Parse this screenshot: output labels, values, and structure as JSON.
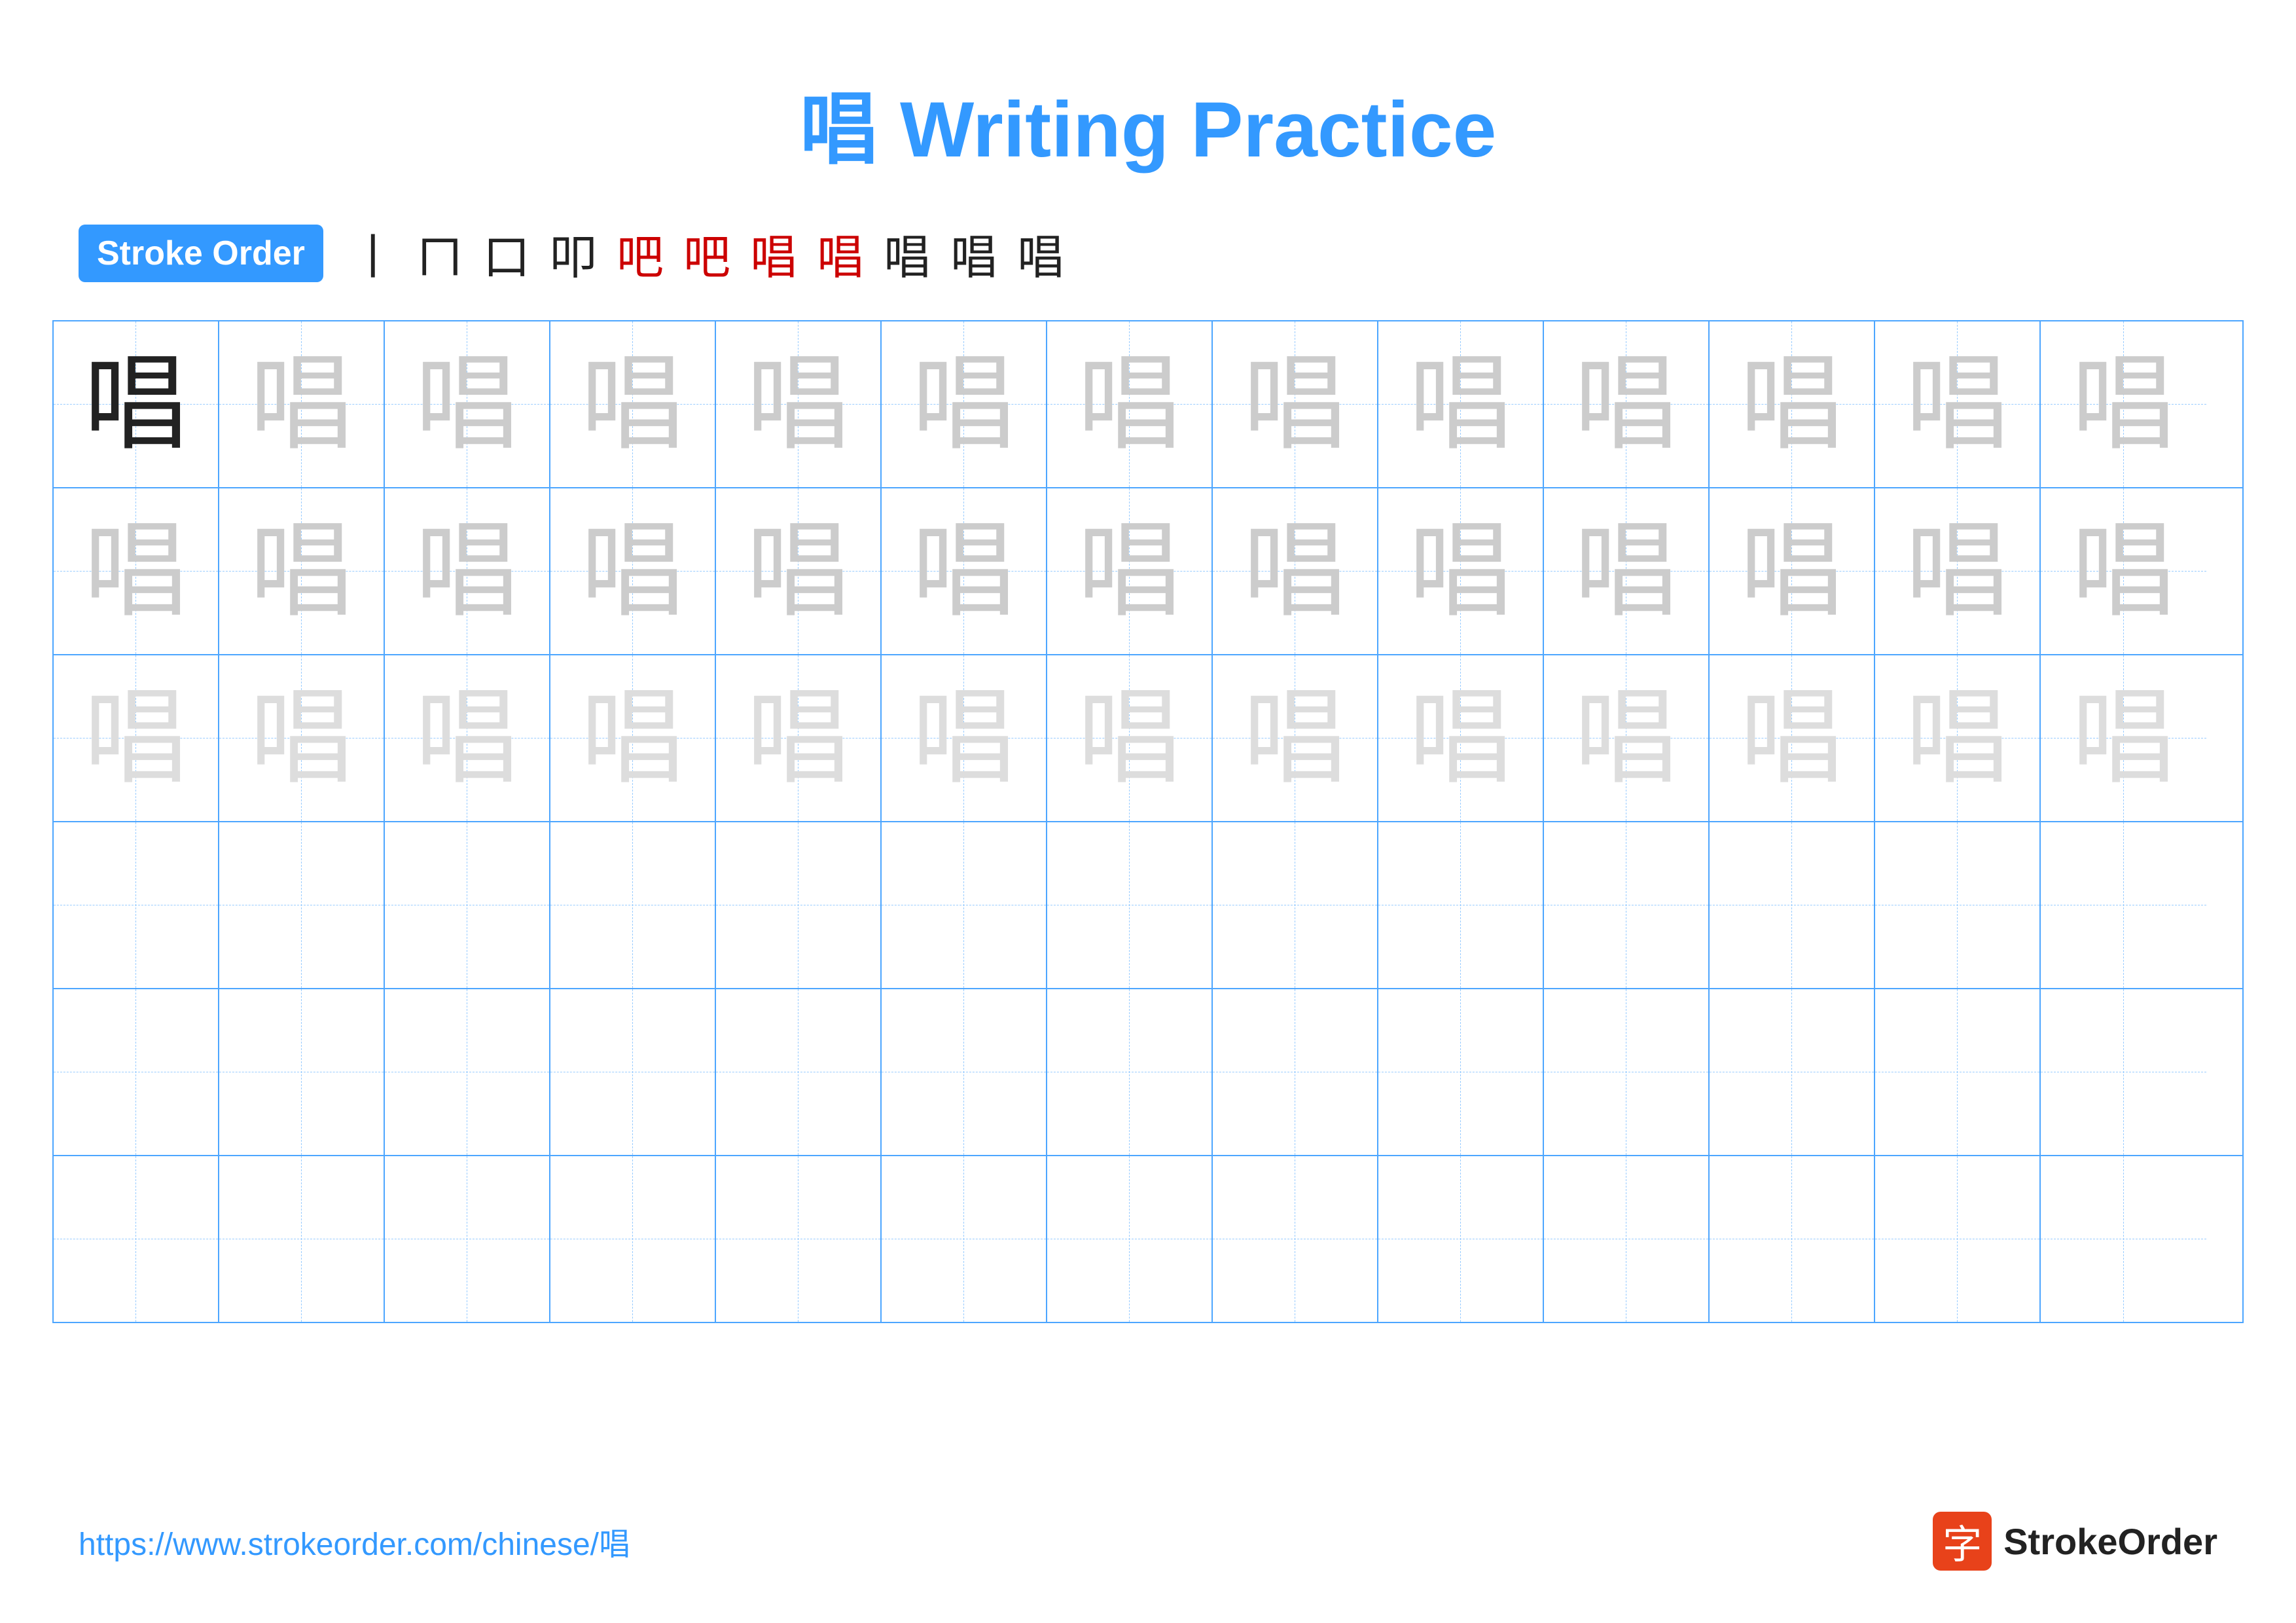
{
  "title": {
    "char": "唱",
    "text": " Writing Practice"
  },
  "stroke_order": {
    "badge_label": "Stroke Order",
    "steps": [
      "丨",
      "𠃌",
      "口",
      "口丨",
      "口冂",
      "口冂一",
      "口口",
      "口口丨",
      "唱",
      "唱",
      "唱"
    ]
  },
  "grid": {
    "rows": 6,
    "cols": 13,
    "char": "唱",
    "row_patterns": [
      [
        "solid",
        "ghost-dark",
        "ghost-dark",
        "ghost-dark",
        "ghost-dark",
        "ghost-dark",
        "ghost-dark",
        "ghost-dark",
        "ghost-dark",
        "ghost-dark",
        "ghost-dark",
        "ghost-dark",
        "ghost-dark"
      ],
      [
        "ghost-dark",
        "ghost-dark",
        "ghost-dark",
        "ghost-dark",
        "ghost-dark",
        "ghost-dark",
        "ghost-dark",
        "ghost-dark",
        "ghost-dark",
        "ghost-dark",
        "ghost-dark",
        "ghost-dark",
        "ghost-dark"
      ],
      [
        "ghost-light",
        "ghost-light",
        "ghost-light",
        "ghost-light",
        "ghost-light",
        "ghost-light",
        "ghost-light",
        "ghost-light",
        "ghost-light",
        "ghost-light",
        "ghost-light",
        "ghost-light",
        "ghost-light"
      ],
      [
        "empty",
        "empty",
        "empty",
        "empty",
        "empty",
        "empty",
        "empty",
        "empty",
        "empty",
        "empty",
        "empty",
        "empty",
        "empty"
      ],
      [
        "empty",
        "empty",
        "empty",
        "empty",
        "empty",
        "empty",
        "empty",
        "empty",
        "empty",
        "empty",
        "empty",
        "empty",
        "empty"
      ],
      [
        "empty",
        "empty",
        "empty",
        "empty",
        "empty",
        "empty",
        "empty",
        "empty",
        "empty",
        "empty",
        "empty",
        "empty",
        "empty"
      ]
    ]
  },
  "footer": {
    "url": "https://www.strokeorder.com/chinese/唱",
    "logo_icon": "字",
    "logo_text": "StrokeOrder"
  }
}
